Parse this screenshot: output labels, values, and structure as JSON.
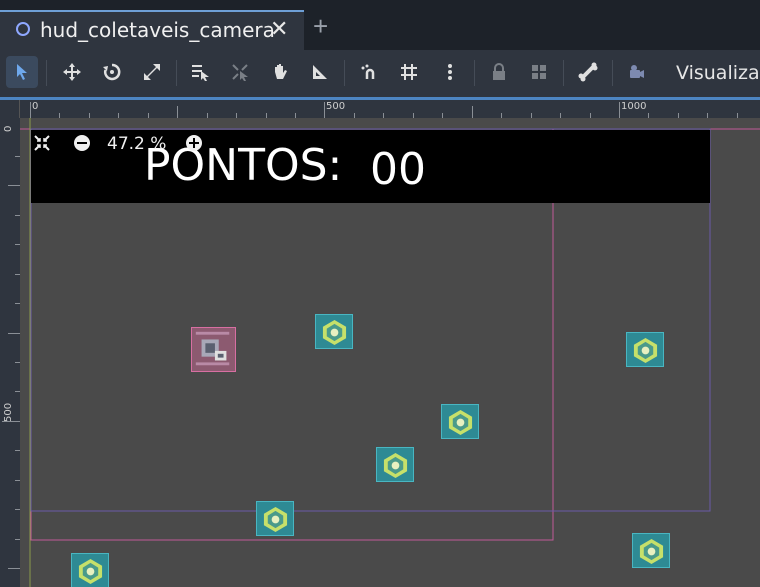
{
  "tab": {
    "title": "hud_coletaveis_camera",
    "close": "✕",
    "add": "+"
  },
  "toolbar": {
    "items": [
      "select-tool",
      "move-tool",
      "rotate-tool",
      "scale-tool",
      "list-select-tool",
      "pivot-tool",
      "pan-tool",
      "ruler-tool",
      "smart-snap-toggle",
      "grid-snap-toggle",
      "snap-options",
      "lock-node",
      "group-nodes",
      "skeleton-options",
      "camera-override"
    ],
    "view_menu": "Visualizar"
  },
  "ruler": {
    "top_labels": [
      "0",
      "500",
      "1000"
    ],
    "left_labels": [
      "0",
      "500"
    ]
  },
  "hud": {
    "label": "PONTOS:",
    "value": "00"
  },
  "zoom": {
    "value": "47.2 %"
  },
  "colors": {
    "accent": "#4d85c2",
    "coin_bg": "#2e8a94",
    "player_bg": "#8c5a70",
    "guide_pink": "#c05a98",
    "guide_purple": "#6a5aa8"
  }
}
